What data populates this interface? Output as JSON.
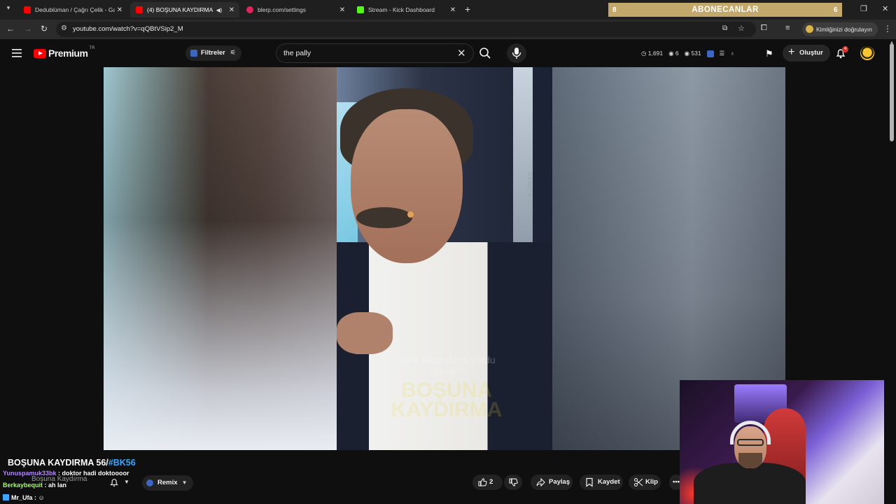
{
  "browser": {
    "tab_list_icon": "chevron-down-icon",
    "tabs": [
      {
        "title": "Dedublüman / Çağrı Çelik - Gaz",
        "icon": "youtube-icon",
        "color": "#ff0000"
      },
      {
        "title": "(4) BOŞUNA KAYDIRMA 56/",
        "icon": "youtube-icon",
        "color": "#ff0000"
      },
      {
        "title": "blerp.com/settings",
        "icon": "blerp-icon",
        "color": "#e0245e"
      },
      {
        "title": "Stream - Kick Dashboard",
        "icon": "kick-icon",
        "color": "#53fc18"
      }
    ],
    "new_tab": "+",
    "overlay_banner": {
      "left": "8",
      "center": "ABONECANLAR",
      "right": "6"
    },
    "url": "youtube.com/watch?v=qQBtVSip2_M",
    "verify_label": "Kimliğinizi doğrulayın"
  },
  "youtube": {
    "logo_text": "Premium",
    "country_code": "TR",
    "filters_label": "Filtreler",
    "search": {
      "value": "the pally"
    },
    "stats": {
      "views": "1,691",
      "likes": "6",
      "comments": "531"
    },
    "create_label": "Oluştur",
    "notification_count": "4"
  },
  "video": {
    "brand_vertical": "GENÇ MOTTO",
    "subtitle_lines": [
      "trafik falan durduyordu",
      "abi yani"
    ],
    "watermark": "BOŞUNA KAYDIRMA",
    "title": "BOŞUNA KAYDIRMA 56/",
    "hashtag": "#BK56",
    "channel": "Boşuna Kaydırma",
    "remix_label": "Remix",
    "like_count": "2",
    "share_label": "Paylaş",
    "save_label": "Kaydet",
    "clip_label": "Klip",
    "more_label": "•••"
  },
  "chat": [
    {
      "user": "Yunuspamuk33bk",
      "message": ": doktor hadi doktoooor"
    },
    {
      "user": "Berkaybequit",
      "message": ": ah lan"
    },
    {
      "user": "Mr_Ufa",
      "message": ":"
    }
  ],
  "colors": {
    "accent": "#3ea6ff",
    "youtube_red": "#ff0000",
    "banner": "#c2a86a"
  }
}
